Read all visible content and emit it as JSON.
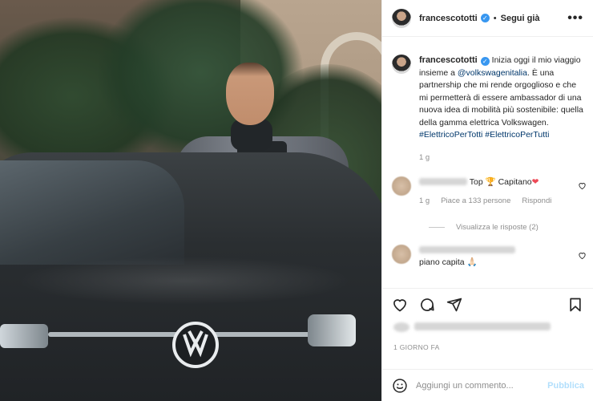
{
  "post": {
    "username": "francescototti",
    "follow_label": "Segui già",
    "more_label": "•••"
  },
  "caption": {
    "username": "francescototti",
    "text_1": "Inizia oggi il mio viaggio insieme a ",
    "mention": "@volkswagenitalia",
    "text_2": ". È una partnership che mi rende orgoglioso e che mi permetterà di essere ambassador di una nuova idea di mobilità più sostenibile: quella della gamma elettrica Volkswagen.",
    "tag_1": "#ElettricoPerTotti",
    "tag_2": "#ElettricoPerTutti",
    "time": "1 g"
  },
  "comments": [
    {
      "text": "Top",
      "text_2": "Capitano",
      "heart": "❤",
      "time": "1 g",
      "likes": "Piace a 133 persone",
      "reply": "Rispondi",
      "view_replies": "Visualizza le risposte (2)"
    },
    {
      "text": "piano capita",
      "emoji": "🙏🏻"
    }
  ],
  "footer": {
    "time_ago": "1 GIORNO FA",
    "comment_placeholder": "Aggiungi un commento...",
    "publish_label": "Pubblica"
  },
  "colors": {
    "link": "#00376b",
    "verified": "#3897f0",
    "muted": "#8e8e8e",
    "publish_disabled": "#b2dffc"
  }
}
